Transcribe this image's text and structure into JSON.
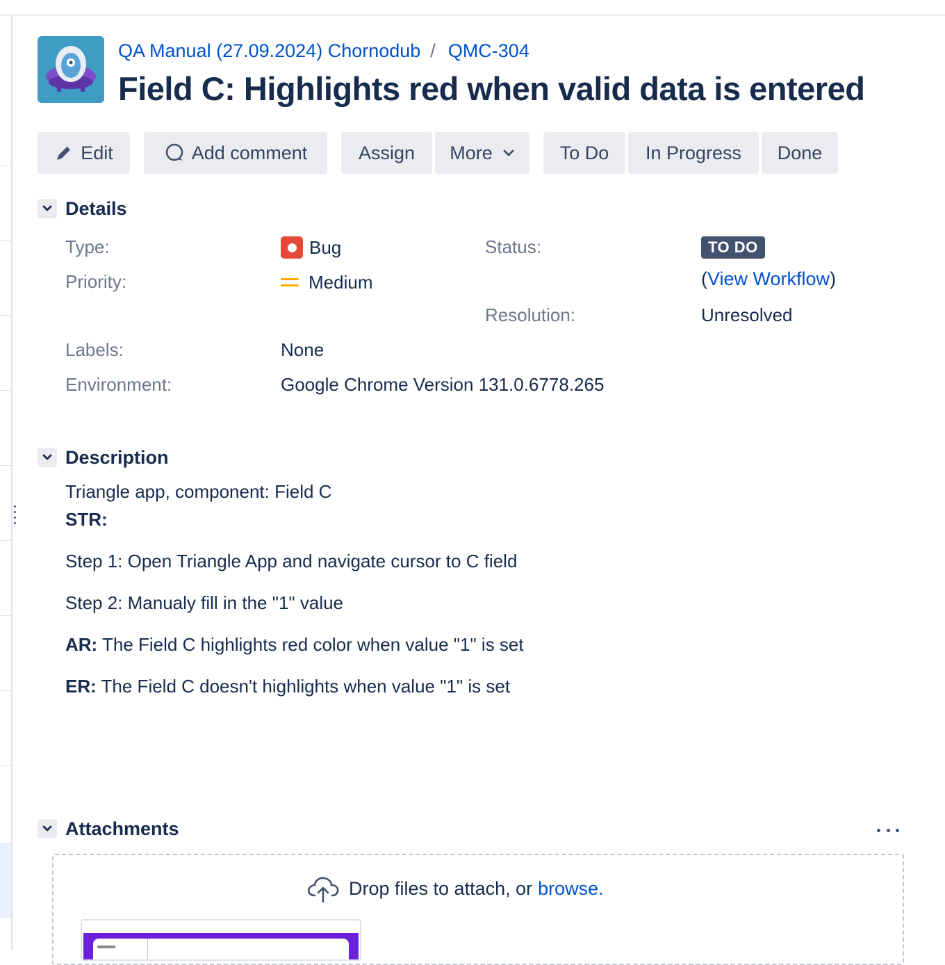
{
  "breadcrumb": {
    "project": "QA Manual (27.09.2024) Chornodub",
    "separator": "/",
    "issue_key": "QMC-304"
  },
  "issue": {
    "title": "Field C: Highlights red when valid data is entered"
  },
  "toolbar": {
    "edit": "Edit",
    "add_comment": "Add comment",
    "assign": "Assign",
    "more": "More",
    "todo": "To Do",
    "in_progress": "In Progress",
    "done": "Done"
  },
  "details": {
    "heading": "Details",
    "type_label": "Type:",
    "type_value": "Bug",
    "priority_label": "Priority:",
    "priority_value": "Medium",
    "labels_label": "Labels:",
    "labels_value": "None",
    "environment_label": "Environment:",
    "environment_value": "Google Chrome Version 131.0.6778.265",
    "status_label": "Status:",
    "status_value": "TO DO",
    "view_workflow": "View Workflow",
    "resolution_label": "Resolution:",
    "resolution_value": "Unresolved"
  },
  "description": {
    "heading": "Description",
    "intro": "Triangle app, component: Field C",
    "str_label": "STR:",
    "step1": "Step 1: Open Triangle App and navigate cursor to C field",
    "step2": "Step 2: Manualy fill in the \"1\" value",
    "ar_label": "AR:",
    "ar_text": " The Field C highlights red color when value \"1\" is set",
    "er_label": "ER:",
    "er_text": " The Field C doesn't highlights when value \"1\" is set"
  },
  "attachments": {
    "heading": "Attachments",
    "drop_text": "Drop files to attach, or ",
    "browse": "browse."
  },
  "colors": {
    "link": "#0052cc",
    "text": "#172b4d",
    "label": "#6b778c",
    "button_bg": "#ebecf0",
    "status_lozenge": "#42526e",
    "bug": "#e5493a",
    "priority_medium": "#ffab00"
  },
  "icons": {
    "edit": "pencil-icon",
    "comment": "comment-bubble-icon",
    "more": "chevron-down-icon",
    "section_toggle": "chevron-down-icon",
    "attachments_menu": "more-horizontal-icon",
    "drop": "cloud-upload-icon"
  }
}
